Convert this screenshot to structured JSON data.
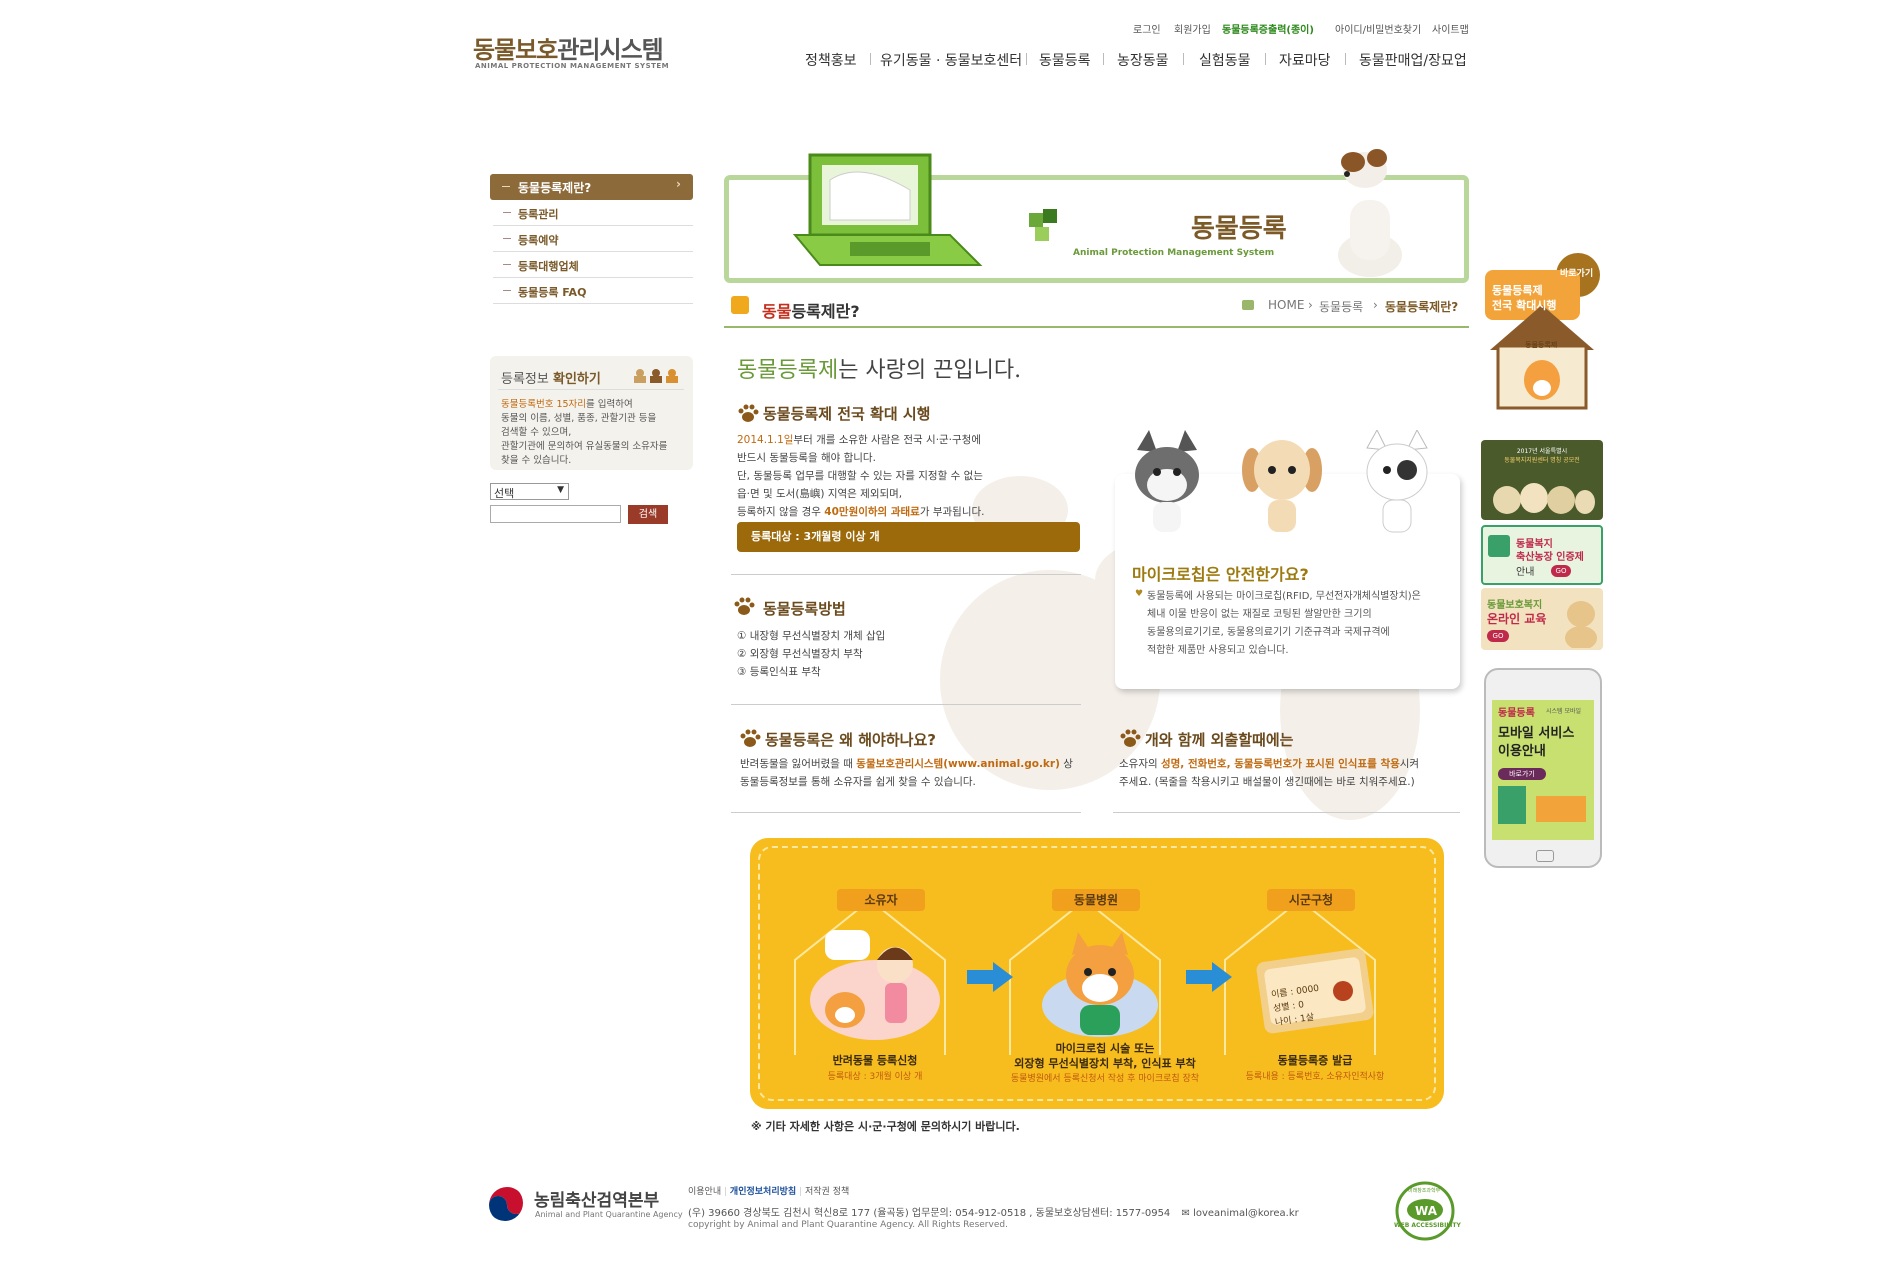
{
  "header": {
    "logo_title_a": "동물보호",
    "logo_title_b": "관리시스템",
    "logo_subtitle": "ANIMAL PROTECTION MANAGEMENT SYSTEM",
    "util_links": [
      "로그인",
      "회원가입",
      "동물등록증출력(종이)",
      "아이디/비밀번호찾기",
      "사이트맵"
    ],
    "gnb": [
      "정책홍보",
      "유기동물 · 동물보호센터",
      "동물등록",
      "농장동물",
      "실험동물",
      "자료마당",
      "동물판매업/장묘업"
    ]
  },
  "sidebar": {
    "active": "동물등록제란?",
    "items": [
      "등록관리",
      "등록예약",
      "등록대행업체",
      "동물등록 FAQ"
    ]
  },
  "reg_info": {
    "title_a": "등록정보 ",
    "title_b": "확인하기",
    "desc_hl": "동물등록번호 15자리",
    "desc_1": "를 입력하여",
    "desc_2": "동물의 이름, 성별, 품종, 관할기관 등을",
    "desc_3": "검색할 수 있으며,",
    "desc_4": "관할기관에 문의하여 유실동물의 소유자를",
    "desc_5": "찾을 수 있습니다.",
    "select_value": "선택",
    "search_label": "검색"
  },
  "banner": {
    "title": "동물등록",
    "subtitle": "Animal Protection Management System"
  },
  "page": {
    "title_a": "동물",
    "title_b": "등록제란?",
    "breadcrumb": [
      "HOME",
      "동물등록",
      "동물등록제란?"
    ]
  },
  "content": {
    "headline_a": "동물등록제",
    "headline_b": "는 사랑의 끈입니다.",
    "sec1_title": "동물등록제 전국 확대 시행",
    "sec1_l1_hl": "2014.1.1일",
    "sec1_l1": "부터 개를 소유한 사람은 전국 시·군·구청에",
    "sec1_l2": "반드시 동물등록을 해야 합니다.",
    "sec1_l3": "단, 동물등록 업무를 대행할 수 있는 자를 지정할 수 없는",
    "sec1_l4": "읍·면 및 도서(島嶼) 지역은 제외되며,",
    "sec1_l5a": "등록하지 않을 경우 ",
    "sec1_l5hl": "40만원이하의 과태료",
    "sec1_l5b": "가 부과됩니다.",
    "target": "등록대상 : 3개월령 이상 개",
    "sec2_title": "동물등록방법",
    "sec2_items": [
      "① 내장형 무선식별장치 개체 삽입",
      "② 외장형 무선식별장치 부착",
      "③ 등록인식표 부착"
    ],
    "chip_title": "마이크로칩은 안전한가요?",
    "chip_l1": "동물등록에 사용되는 마이크로칩(RFID, 무선전자개체식별장치)은",
    "chip_l2": "체내 이물 반응이 없는 재질로 코팅된 쌀알만한 크기의",
    "chip_l3": "동물용의료기기로, 동물용의료기기 기준규격과 국제규격에",
    "chip_l4": "적합한 제품만 사용되고 있습니다.",
    "sec3_title": "동물등록은 왜 해야하나요?",
    "sec3_l1a": "반려동물을 잃어버렸을 때 ",
    "sec3_l1hl": "동물보호관리시스템(www.animal.go.kr)",
    "sec3_l1b": " 상",
    "sec3_l2": "동물등록정보를 통해 소유자를 쉽게 찾을 수 있습니다.",
    "sec4_title": "개와 함께 외출할때에는",
    "sec4_l1a": "소유자의 ",
    "sec4_l1hl": "성명, 전화번호, 동물등록번호가 표시된 인식표를 착용",
    "sec4_l1b": "시켜",
    "sec4_l2": "주세요. (목줄을 착용시키고 배설물이 생긴때에는 바로 치워주세요.)"
  },
  "process": {
    "steps": [
      {
        "label": "소유자",
        "title": "반려동물 등록신청",
        "sub": "등록대상 : 3개월 이상 개"
      },
      {
        "label": "동물병원",
        "title1": "마이크로칩 시술 또는",
        "title2": "외장형 무선식별장치 부착, 인식표 부착",
        "sub": "동물병원에서 등록신청서 작성 후 마이크로칩 장착"
      },
      {
        "label": "시군구청",
        "title": "동물등록증 발급",
        "sub": "등록내용 : 등록번호, 소유자인적사항"
      }
    ],
    "card_text": [
      "이름 : 0000",
      "성별 : 0",
      "나이 : 1살"
    ],
    "note": "※ 기타 자세한 사항은 시·군·구청에 문의하시기 바랍니다."
  },
  "right_banners": {
    "b1_tag": "바로가기",
    "b1_l1": "동물등록제",
    "b1_l2": "전국 확대시행",
    "b1_sign": "동물등록제",
    "b2_l1": "2017년 서울특별시",
    "b2_l2": "동물복지지원센터 명칭 공모전",
    "b3_l1": "동물복지",
    "b3_l2": "축산농장 인증제",
    "b3_l3": "안내",
    "b3_go": "GO",
    "b4_l1": "동물보호복지",
    "b4_l2": "온라인 교육",
    "b4_go": "GO",
    "b5_l1": "동물등록",
    "b5_l1b": "시스템 모바일",
    "b5_l2": "모바일 서비스",
    "b5_l3": "이용안내",
    "b5_btn": "바로가기"
  },
  "footer": {
    "org": "농림축산검역본부",
    "org_en": "Animal and Plant Quarantine Agency",
    "links": [
      "이용안내",
      "개인정보처리방침",
      "저작권 정책"
    ],
    "address": "(우) 39660  경상북도 김천시 혁신8로 177 (율곡동)   업무문의: 054-912-0518 ,  동물보호상담센터: 1577-0954",
    "email": "loveanimal@korea.kr",
    "copyright": "copyright by Animal and Plant Quarantine Agency. All Rights Reserved.",
    "wa_top": "미래창조과학부",
    "wa_label": "WEB ACCESSIBILITY"
  },
  "colors": {
    "brand_brown": "#8d6a3a",
    "green_accent": "#6a9a3a",
    "process_yellow": "#f7bd1e"
  }
}
